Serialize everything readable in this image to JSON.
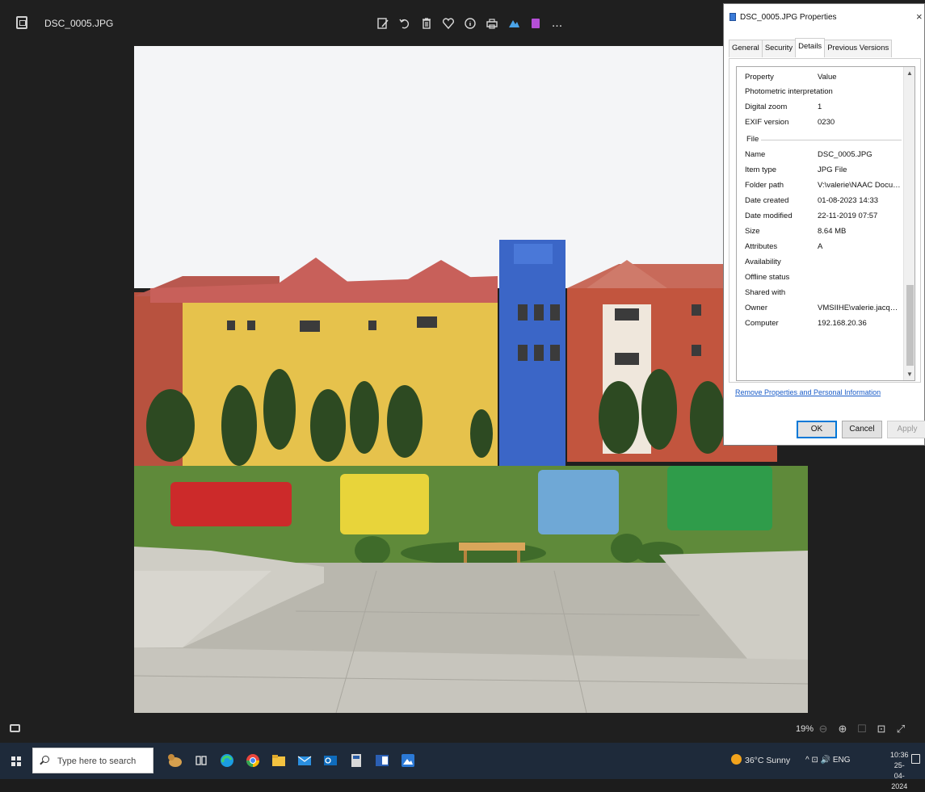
{
  "viewer": {
    "file_title": "DSC_0005.JPG",
    "toolbar_icons": [
      "edit-image-icon",
      "rotate-icon",
      "delete-icon",
      "favorite-icon",
      "info-icon",
      "print-icon",
      "edit-app-icon",
      "clipchamp-icon",
      "more-icon"
    ],
    "more_label": "...",
    "zoom_level": "19%"
  },
  "dialog": {
    "title": "DSC_0005.JPG Properties",
    "close": "×",
    "tabs": [
      "General",
      "Security",
      "Details",
      "Previous Versions"
    ],
    "active_tab": "Details",
    "columns": {
      "property": "Property",
      "value": "Value"
    },
    "rows_top": [
      {
        "k": "Photometric interpretation",
        "v": ""
      },
      {
        "k": "Digital zoom",
        "v": "1"
      },
      {
        "k": "EXIF version",
        "v": "0230"
      }
    ],
    "group_label": "File",
    "rows_file": [
      {
        "k": "Name",
        "v": "DSC_0005.JPG"
      },
      {
        "k": "Item type",
        "v": "JPG File"
      },
      {
        "k": "Folder path",
        "v": "V:\\valerie\\NAAC Documen..."
      },
      {
        "k": "Date created",
        "v": "01-08-2023 14:33"
      },
      {
        "k": "Date modified",
        "v": "22-11-2019 07:57"
      },
      {
        "k": "Size",
        "v": "8.64 MB"
      },
      {
        "k": "Attributes",
        "v": "A"
      },
      {
        "k": "Availability",
        "v": ""
      },
      {
        "k": "Offline status",
        "v": ""
      },
      {
        "k": "Shared with",
        "v": ""
      },
      {
        "k": "Owner",
        "v": "VMSIIHE\\valerie.jacques"
      },
      {
        "k": "Computer",
        "v": "192.168.20.36"
      }
    ],
    "remove_link": "Remove Properties and Personal Information",
    "buttons": {
      "ok": "OK",
      "cancel": "Cancel",
      "apply": "Apply"
    }
  },
  "taskbar": {
    "search_placeholder": "Type here to search",
    "weather": "36°C  Sunny",
    "tray_text": "^  ⊡  🔊  ENG",
    "time": "10:36",
    "date": "25-04-2024"
  },
  "colors": {
    "viewer_bg": "#1f1f1f",
    "taskbar_bg": "#1e2a3a",
    "link": "#1a5cc8",
    "ok_border": "#0078d7"
  }
}
